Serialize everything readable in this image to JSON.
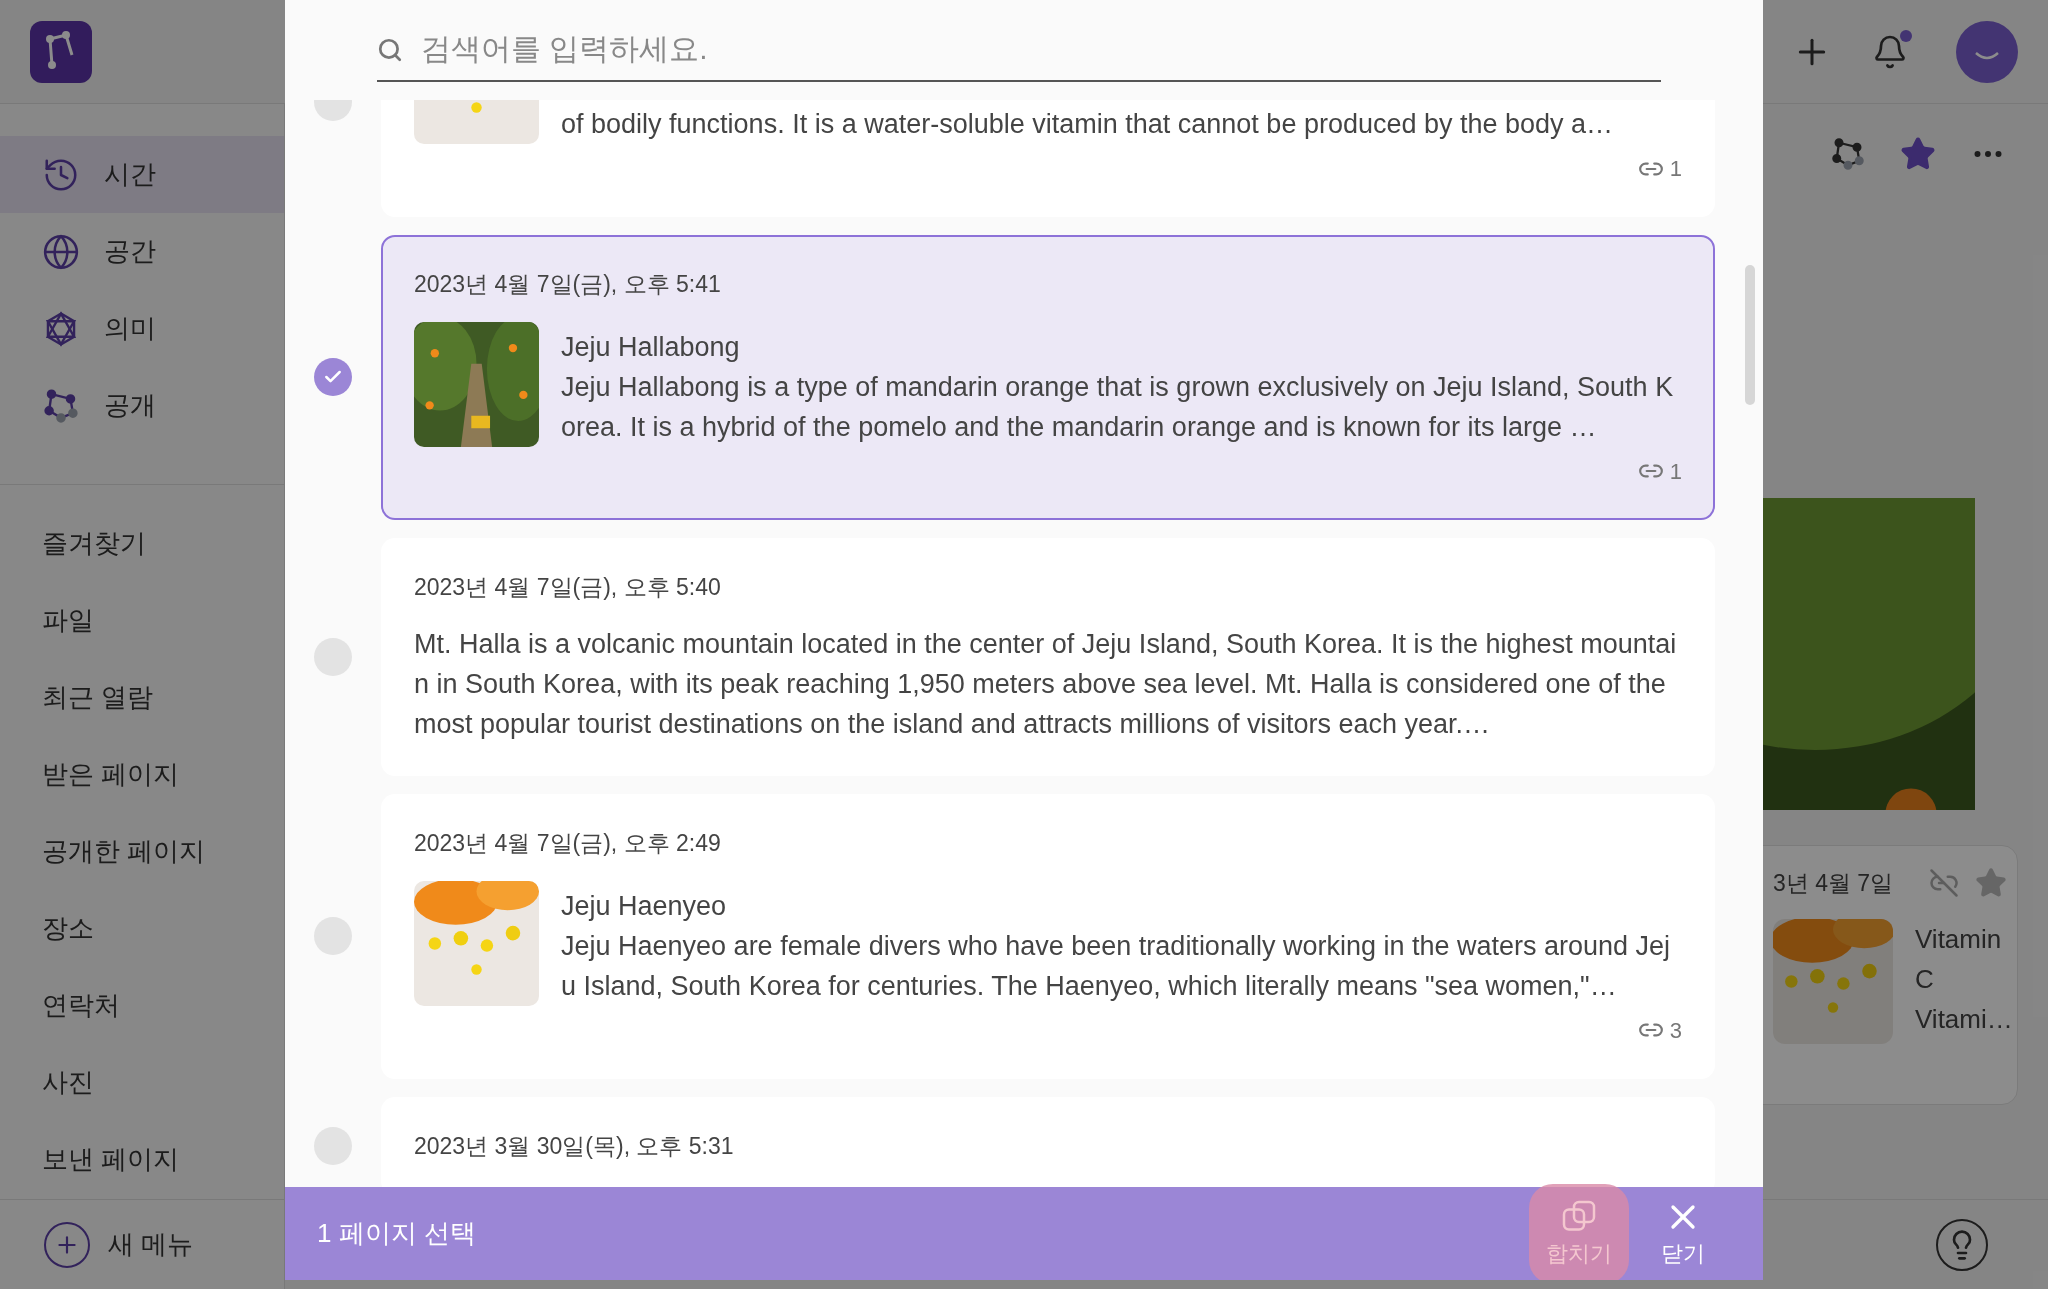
{
  "sidebar": {
    "nav": [
      {
        "label": "시간",
        "selected": true
      },
      {
        "label": "공간",
        "selected": false
      },
      {
        "label": "의미",
        "selected": false
      },
      {
        "label": "공개",
        "selected": false
      }
    ],
    "menu": [
      "즐겨찾기",
      "파일",
      "최근 열람",
      "받은 페이지",
      "공개한 페이지",
      "장소",
      "연락처",
      "사진",
      "보낸 페이지"
    ],
    "new_menu": "새 메뉴"
  },
  "header": {
    "unread_notifications": true
  },
  "preview_card": {
    "date": "3년 4월 7일",
    "title": "Vitamin C Vitami…",
    "starred": false
  },
  "search": {
    "placeholder": "검색어를 입력하세요."
  },
  "pages": [
    {
      "body": "of bodily functions. It is a water-soluble vitamin that cannot be produced by the body a…",
      "links": "1",
      "selected": false
    },
    {
      "date": "2023년 4월 7일(금), 오후 5:41",
      "title": "Jeju Hallabong",
      "body": "Jeju Hallabong is a type of mandarin orange that is grown exclusively on Jeju Island, South Korea. It is a hybrid of the pomelo and the mandarin orange and is known for its large …",
      "links": "1",
      "selected": true
    },
    {
      "date": "2023년 4월 7일(금), 오후 5:40",
      "body": "Mt. Halla is a volcanic mountain located in the center of Jeju Island, South Korea. It is the highest mountain in South Korea, with its peak reaching 1,950 meters above sea level. Mt. Halla is considered one of the most popular tourist destinations on the island and attracts millions of visitors each year.…",
      "selected": false
    },
    {
      "date": "2023년 4월 7일(금), 오후 2:49",
      "title": "Jeju Haenyeo",
      "body": "Jeju Haenyeo are female divers who have been traditionally working in the waters around Jeju Island, South Korea for centuries. The Haenyeo, which literally means \"sea women,\"…",
      "links": "3",
      "selected": false
    },
    {
      "date": "2023년 3월 30일(목), 오후 5:31",
      "selected": false
    }
  ],
  "selection_bar": {
    "label": "1 페이지 선택",
    "actions": [
      {
        "kind": "merge",
        "label": "합치기",
        "highlighted": true
      },
      {
        "kind": "close",
        "label": "닫기",
        "highlighted": false
      }
    ]
  }
}
